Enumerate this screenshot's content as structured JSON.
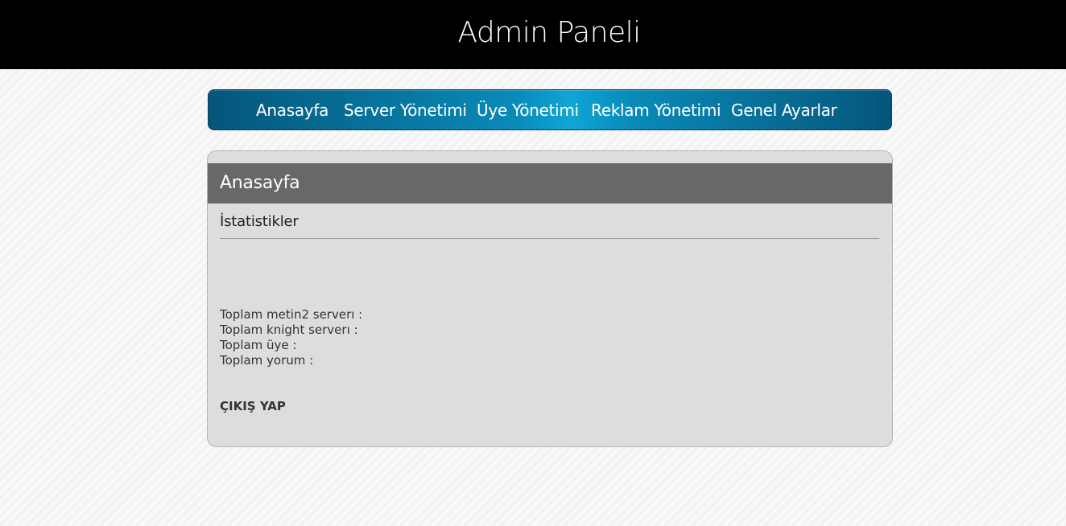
{
  "header": {
    "title": "Admin Paneli"
  },
  "nav": {
    "items": [
      {
        "label": "Anasayfa"
      },
      {
        "label": "Server Yönetimi"
      },
      {
        "label": "Üye Yönetimi"
      },
      {
        "label": "Reklam Yönetimi"
      },
      {
        "label": "Genel Ayarlar"
      }
    ]
  },
  "panel": {
    "title": "Anasayfa",
    "section_title": "İstatistikler",
    "stats": [
      {
        "label": "Toplam metin2 serverı :"
      },
      {
        "label": "Toplam knight serverı :"
      },
      {
        "label": "Toplam üye :"
      },
      {
        "label": "Toplam yorum :"
      }
    ],
    "logout_label": "ÇIKIŞ YAP"
  },
  "colors": {
    "header_bg": "#000000",
    "nav_dark": "#05567a",
    "nav_light": "#0fa6d6",
    "panel_bg": "#dddddd",
    "panel_title_bg": "#686868"
  }
}
